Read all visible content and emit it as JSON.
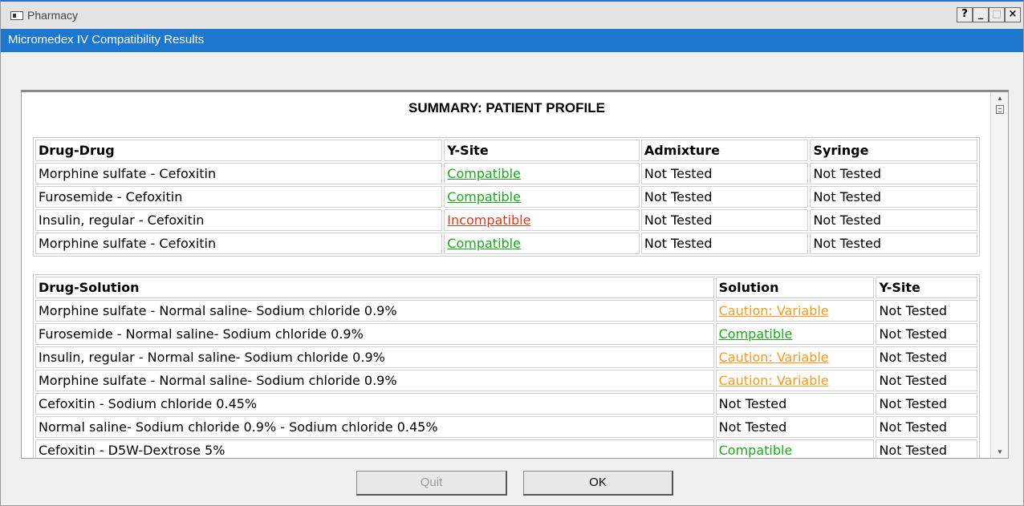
{
  "window": {
    "title": "Pharmacy",
    "help": "?",
    "minimize": "_",
    "maximize": "□",
    "close": "×"
  },
  "header": {
    "title": "Micromedex IV Compatibility Results"
  },
  "summary": {
    "title": "SUMMARY: PATIENT PROFILE"
  },
  "drug_drug": {
    "headers": [
      "Drug-Drug",
      "Y-Site",
      "Admixture",
      "Syringe"
    ],
    "rows": [
      {
        "pair": "Morphine sulfate - Cefoxitin",
        "ysite": "Compatible",
        "admixture": "Not Tested",
        "syringe": "Not Tested"
      },
      {
        "pair": "Furosemide - Cefoxitin",
        "ysite": "Compatible",
        "admixture": "Not Tested",
        "syringe": "Not Tested"
      },
      {
        "pair": "Insulin, regular - Cefoxitin",
        "ysite": "Incompatible",
        "admixture": "Not Tested",
        "syringe": "Not Tested"
      },
      {
        "pair": "Morphine sulfate - Cefoxitin",
        "ysite": "Compatible",
        "admixture": "Not Tested",
        "syringe": "Not Tested"
      }
    ]
  },
  "drug_solution": {
    "headers": [
      "Drug-Solution",
      "Solution",
      "Y-Site"
    ],
    "rows": [
      {
        "pair": "Morphine sulfate - Normal saline- Sodium chloride 0.9%",
        "solution": "Caution: Variable",
        "ysite": "Not Tested"
      },
      {
        "pair": "Furosemide - Normal saline- Sodium chloride 0.9%",
        "solution": "Compatible",
        "ysite": "Not Tested"
      },
      {
        "pair": "Insulin, regular - Normal saline- Sodium chloride 0.9%",
        "solution": "Caution: Variable",
        "ysite": "Not Tested"
      },
      {
        "pair": "Morphine sulfate - Normal saline- Sodium chloride 0.9%",
        "solution": "Caution: Variable",
        "ysite": "Not Tested"
      },
      {
        "pair": "Cefoxitin - Sodium chloride 0.45%",
        "solution": "Not Tested",
        "ysite": "Not Tested"
      },
      {
        "pair": "Normal saline- Sodium chloride 0.9% - Sodium chloride 0.45%",
        "solution": "Not Tested",
        "ysite": "Not Tested"
      },
      {
        "pair": "Cefoxitin - D5W-Dextrose 5%",
        "solution": "Compatible",
        "ysite": "Not Tested"
      }
    ]
  },
  "buttons": {
    "quit": "Quit",
    "ok": "OK"
  },
  "colors": {
    "compatible": "#1fa81f",
    "incompatible": "#d93b1a",
    "caution": "#f59a1f",
    "header_bg": "#1d77ce"
  }
}
